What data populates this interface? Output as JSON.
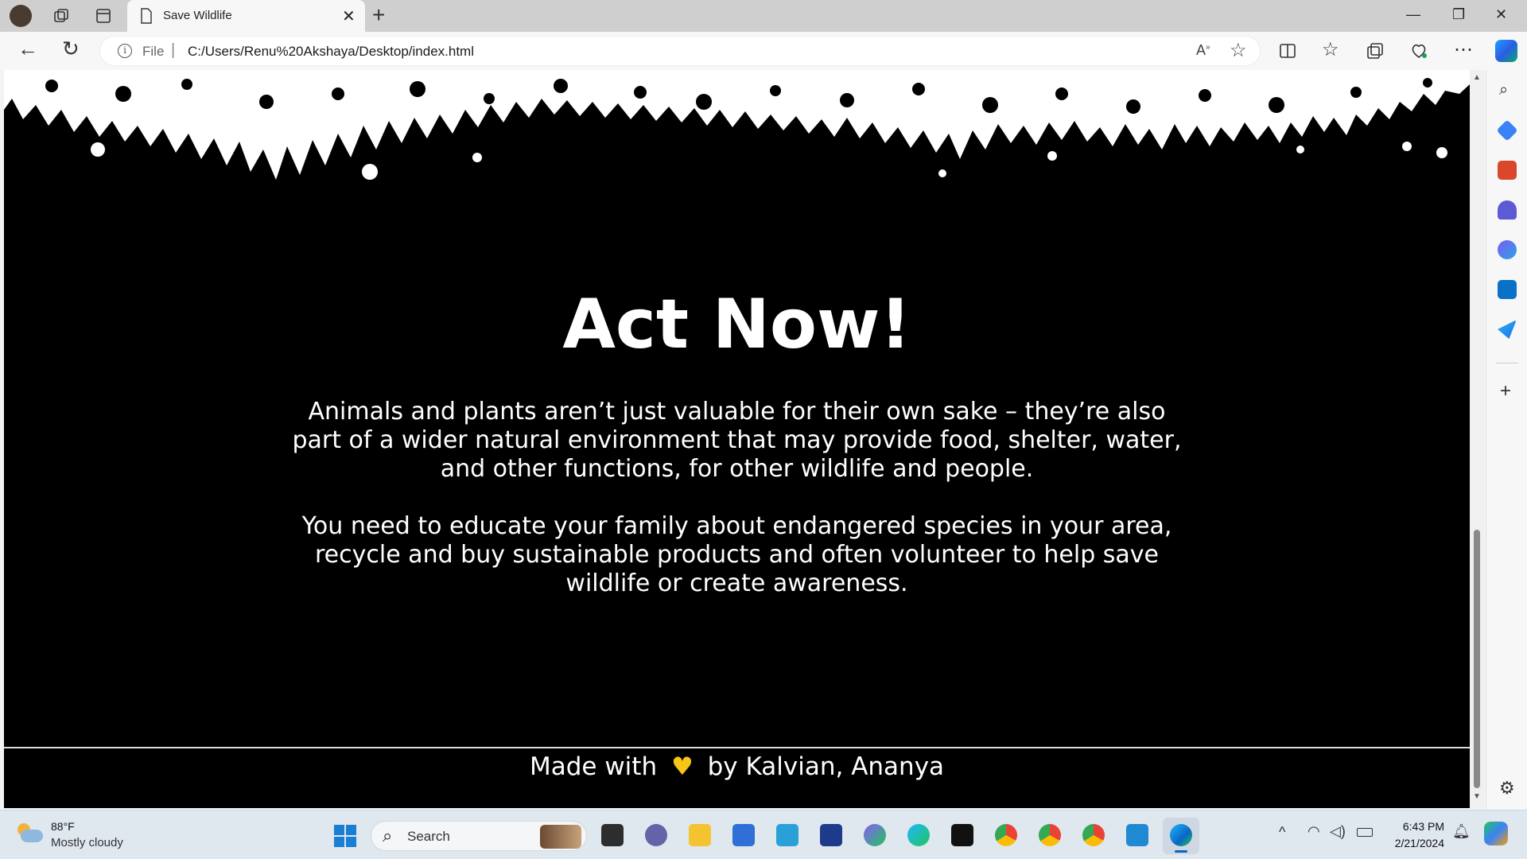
{
  "browser": {
    "tab_title": "Save Wildlife",
    "address_prefix": "File",
    "url": "C:/Users/Renu%20Akshaya/Desktop/index.html"
  },
  "page": {
    "heading": "Act Now!",
    "paragraph1": "Animals and plants aren’t just valuable for their own sake – they’re also part of a wider natural environment that may provide food, shelter, water, and other functions, for other wildlife and people.",
    "paragraph2": "You need to educate your family about endangered species in your area, recycle and buy sustainable products and often volunteer to help save wildlife or create awareness.",
    "footer_prefix": "Made with",
    "footer_suffix": "by Kalvian, Ananya",
    "heart_icon": "yellow-heart-icon"
  },
  "taskbar": {
    "weather_temp": "88°F",
    "weather_desc": "Mostly cloudy",
    "search_label": "Search",
    "time": "6:43 PM",
    "date": "2/21/2024"
  },
  "colors": {
    "page_background": "#000000",
    "text": "#ffffff",
    "heart": "#f5c518",
    "edge_accent": "#0a66c2"
  }
}
